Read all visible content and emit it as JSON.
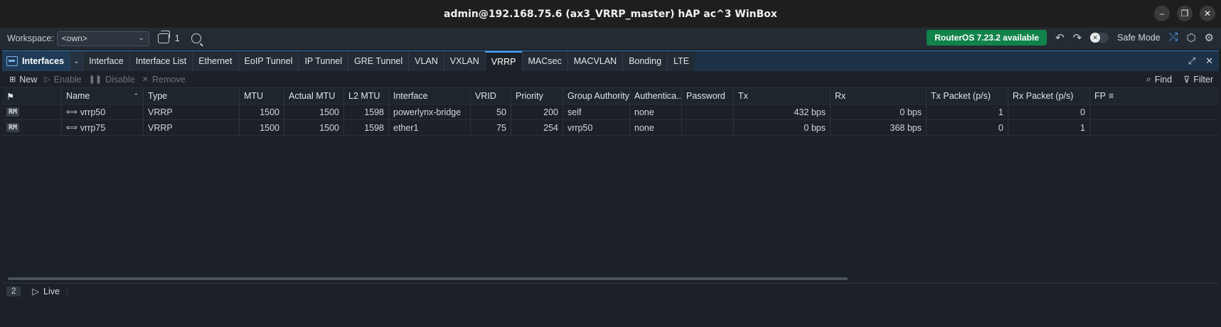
{
  "titlebar": {
    "title": "admin@192.168.75.6 (ax3_VRRP_master) hAP ac^3 WinBox"
  },
  "toolbar": {
    "workspace_label": "Workspace:",
    "workspace_value": "<own>",
    "window_count": "1",
    "update_label": "RouterOS 7.23.2 available",
    "safe_mode_label": "Safe Mode"
  },
  "window": {
    "title": "Interfaces",
    "tabs": [
      "Interface",
      "Interface List",
      "Ethernet",
      "EoIP Tunnel",
      "IP Tunnel",
      "GRE Tunnel",
      "VLAN",
      "VXLAN",
      "VRRP",
      "MACsec",
      "MACVLAN",
      "Bonding",
      "LTE"
    ],
    "active_tab": "VRRP"
  },
  "actions": {
    "new": "New",
    "enable": "Enable",
    "disable": "Disable",
    "remove": "Remove",
    "find": "Find",
    "filter": "Filter"
  },
  "table": {
    "columns": [
      "Name",
      "Type",
      "MTU",
      "Actual MTU",
      "L2 MTU",
      "Interface",
      "VRID",
      "Priority",
      "Group Authority",
      "Authentica...",
      "Password",
      "Tx",
      "Rx",
      "Tx Packet (p/s)",
      "Rx Packet (p/s)",
      "FP"
    ],
    "rows": [
      {
        "flags": "RM",
        "name": "vrrp50",
        "type": "VRRP",
        "mtu": "1500",
        "actual_mtu": "1500",
        "l2_mtu": "1598",
        "interface": "powerlynx-bridge",
        "vrid": "50",
        "priority": "200",
        "group_authority": "self",
        "authentication": "none",
        "password": "",
        "tx": "432 bps",
        "rx": "0 bps",
        "tx_packet": "1",
        "rx_packet": "0"
      },
      {
        "flags": "RM",
        "name": "vrrp75",
        "type": "VRRP",
        "mtu": "1500",
        "actual_mtu": "1500",
        "l2_mtu": "1598",
        "interface": "ether1",
        "vrid": "75",
        "priority": "254",
        "group_authority": "vrrp50",
        "authentication": "none",
        "password": "",
        "tx": "0 bps",
        "rx": "368 bps",
        "tx_packet": "0",
        "rx_packet": "1"
      }
    ]
  },
  "status": {
    "count": "2",
    "live": "Live"
  },
  "colors": {
    "accent": "#4aa3ff",
    "update_badge": "#11834a",
    "background": "#1c2128"
  }
}
